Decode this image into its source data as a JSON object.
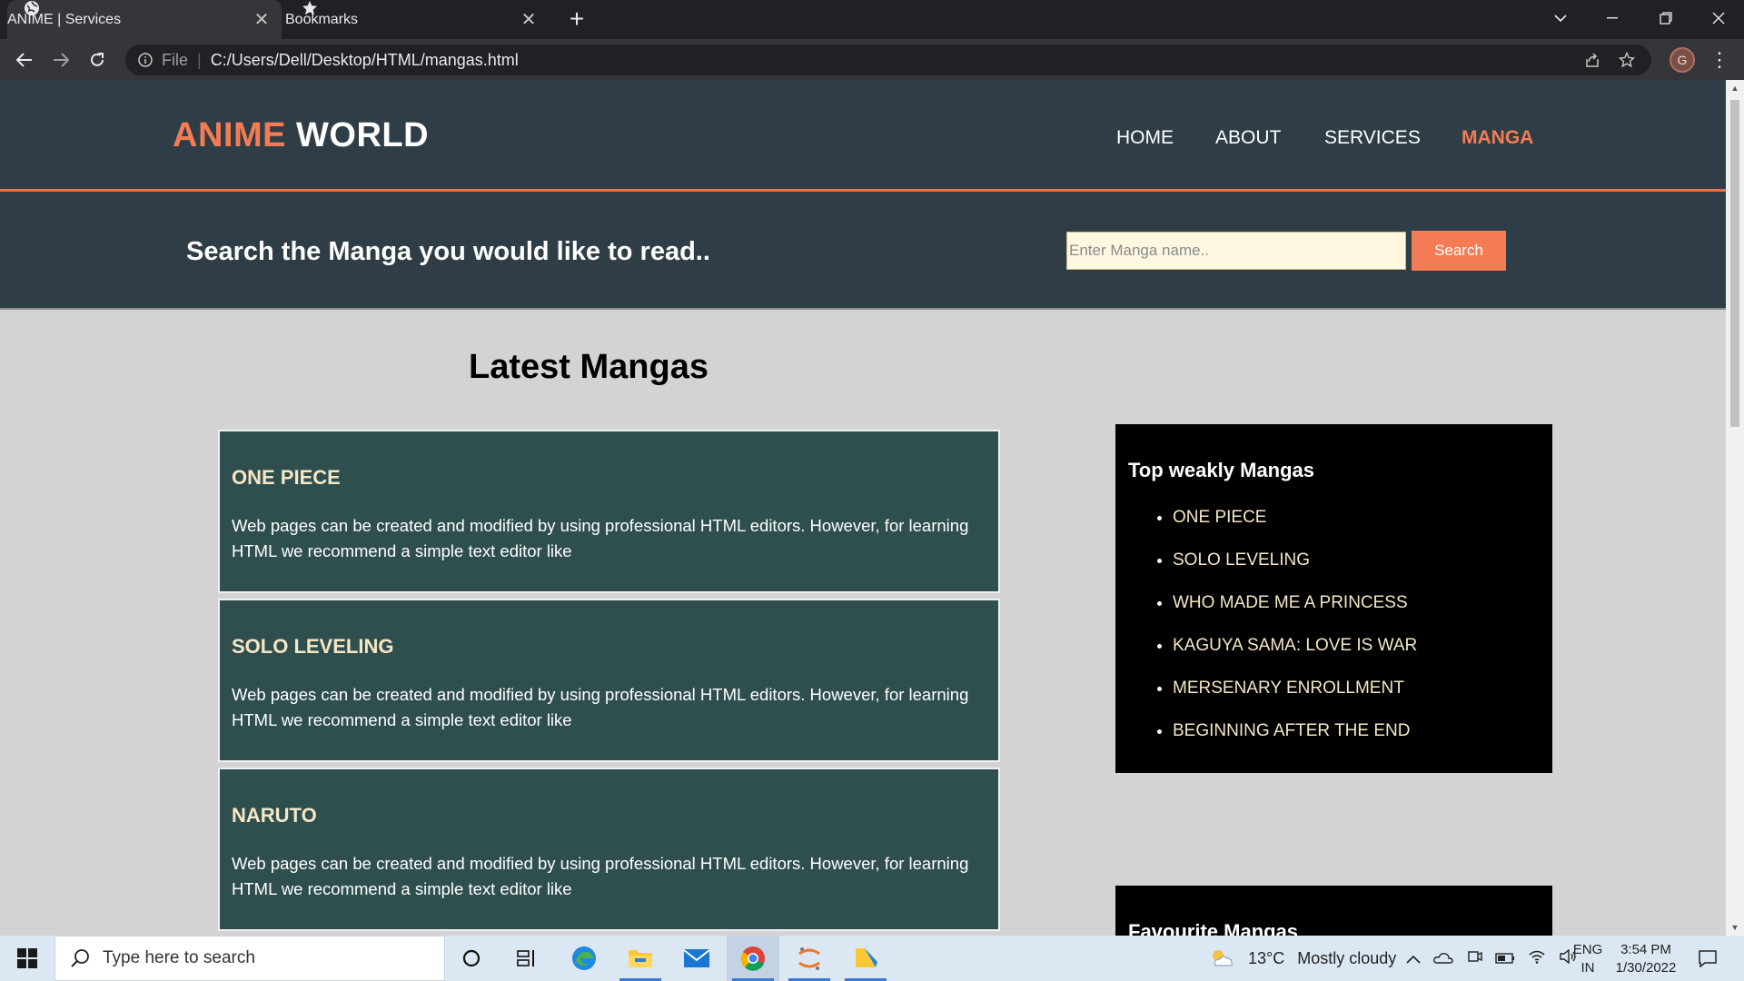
{
  "browser": {
    "tabs": [
      {
        "label": "ANIME | Services",
        "icon": "globe-icon",
        "active": true
      },
      {
        "label": "Bookmarks",
        "icon": "star-icon",
        "active": false
      }
    ],
    "new_tab_glyph": "+",
    "address": {
      "scheme_label": "File",
      "separator": "|",
      "url": "C:/Users/Dell/Desktop/HTML/mangas.html"
    },
    "profile_initial": "G"
  },
  "site": {
    "logo_accent": "ANIME",
    "logo_rest": "WORLD",
    "nav": [
      {
        "label": "HOME",
        "active": false
      },
      {
        "label": "ABOUT",
        "active": false
      },
      {
        "label": "SERVICES",
        "active": false
      },
      {
        "label": "MANGA",
        "active": true
      }
    ],
    "search": {
      "heading": "Search the Manga you would like to read..",
      "placeholder": "Enter Manga name..",
      "button_label": "Search"
    },
    "latest_title": "Latest Mangas",
    "cards": [
      {
        "title": "ONE PIECE",
        "text": "Web pages can be created and modified by using professional HTML editors. However, for learning HTML we recommend a simple text editor like"
      },
      {
        "title": "SOLO LEVELING",
        "text": "Web pages can be created and modified by using professional HTML editors. However, for learning HTML we recommend a simple text editor like"
      },
      {
        "title": "NARUTO",
        "text": "Web pages can be created and modified by using professional HTML editors. However, for learning HTML we recommend a simple text editor like"
      }
    ],
    "top_weekly": {
      "title": "Top weakly Mangas",
      "items": [
        "ONE PIECE",
        "SOLO LEVELING",
        "WHO MADE ME A PRINCESS",
        "KAGUYA SAMA: LOVE IS WAR",
        "MERSENARY ENROLLMENT",
        "BEGINNING AFTER THE END"
      ]
    },
    "favourite": {
      "title": "Favourite Mangas"
    },
    "colors": {
      "header_bg": "#2f3e46",
      "accent": "#f47c55",
      "card_bg": "#2f4f4f",
      "card_title": "#f5e7c6",
      "sidebar_bg": "#000000"
    }
  },
  "taskbar": {
    "search_placeholder": "Type here to search",
    "weather_temp": "13°C",
    "weather_text": "Mostly cloudy",
    "lang_top": "ENG",
    "lang_bottom": "IN",
    "time": "3:54 PM",
    "date": "1/30/2022"
  }
}
